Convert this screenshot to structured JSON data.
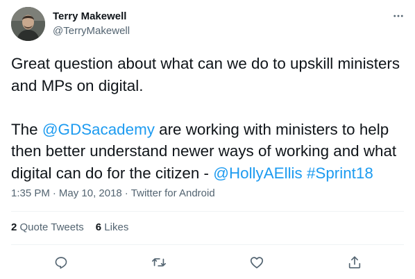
{
  "author": {
    "name": "Terry Makewell",
    "handle": "@TerryMakewell"
  },
  "tweet": {
    "line1_text": "Great question about what can we do to upskill ministers and MPs on digital.",
    "p2_before": "The ",
    "mention_gds": "@GDSacademy",
    "p2_middle": " are working with ministers to help then better understand newer ways of working and what digital can do for the citizen - ",
    "mention_holly": "@HollyAEllis",
    "p2_space": " ",
    "hashtag": "#Sprint18"
  },
  "meta": {
    "time": "1:35 PM",
    "date": "May 10, 2018",
    "source": "Twitter for Android",
    "separator": "·"
  },
  "stats": {
    "quote_count": "2",
    "quote_label": " Quote Tweets",
    "like_count": "6",
    "like_label": " Likes"
  },
  "icons": {
    "more": "more-horizontal-icon",
    "reply": "reply-icon",
    "retweet": "retweet-icon",
    "like": "heart-icon",
    "share": "share-icon"
  },
  "colors": {
    "link": "#1d9bf0",
    "secondary_text": "#536471",
    "primary_text": "#0f1419",
    "divider": "#eff3f4"
  }
}
